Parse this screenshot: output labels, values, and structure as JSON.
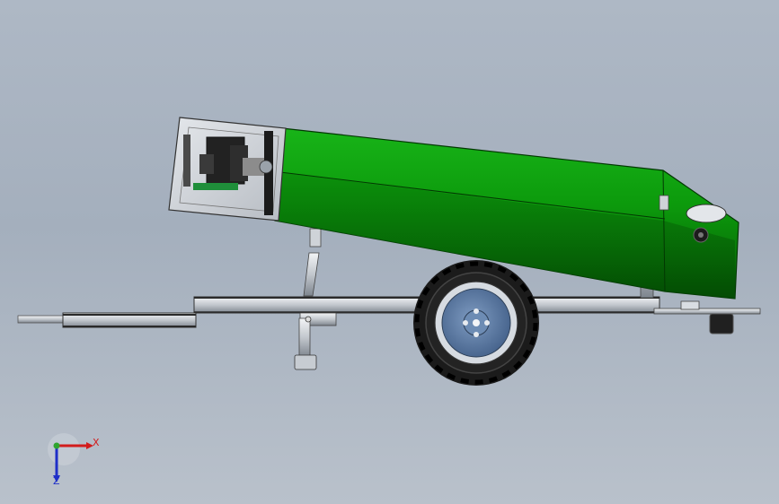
{
  "viewport": {
    "background": "#a9b4c2"
  },
  "model": {
    "body_color": "#0e9a0e",
    "frame_color": "#c9cdd3",
    "tire_color": "#1b1b1b",
    "hub_color": "#5f7fa6",
    "cabinet_color": "#d4d8de"
  },
  "triad": {
    "x_label": "X",
    "z_label": "Z",
    "x_color": "#d21c1c",
    "y_color": "#2fa52f",
    "z_color": "#1f2fc8"
  }
}
